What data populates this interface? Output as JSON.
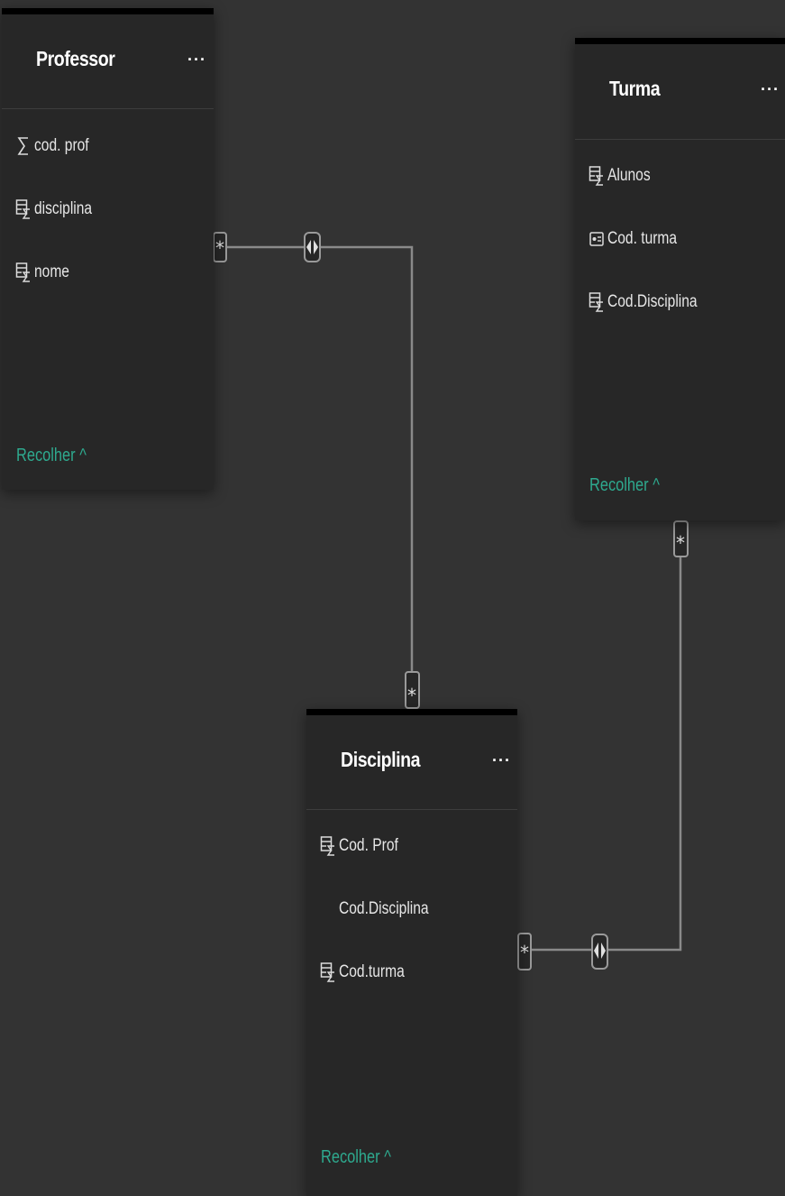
{
  "tables": {
    "professor": {
      "title": "Professor",
      "menu": "···",
      "fields": [
        {
          "label": "cod. prof",
          "icon": "sigma-icon"
        },
        {
          "label": "disciplina",
          "icon": "calculated-column-icon"
        },
        {
          "label": "nome",
          "icon": "calculated-column-icon"
        }
      ],
      "collapse_label": "Recolher ^"
    },
    "turma": {
      "title": "Turma",
      "menu": "···",
      "fields": [
        {
          "label": "Alunos",
          "icon": "calculated-column-icon"
        },
        {
          "label": "Cod. turma",
          "icon": "key-column-icon"
        },
        {
          "label": "Cod.Disciplina",
          "icon": "calculated-column-icon"
        }
      ],
      "collapse_label": "Recolher ^"
    },
    "disciplina": {
      "title": "Disciplina",
      "menu": "···",
      "fields": [
        {
          "label": "Cod. Prof",
          "icon": "calculated-column-icon"
        },
        {
          "label": "Cod.Disciplina",
          "icon": ""
        },
        {
          "label": "Cod.turma",
          "icon": "calculated-column-icon"
        }
      ],
      "collapse_label": "Recolher ^"
    }
  },
  "relationships": [
    {
      "from": "Professor",
      "to": "Disciplina",
      "from_cardinality": "*",
      "to_cardinality": "*",
      "filter": "both-directions-icon"
    },
    {
      "from": "Disciplina",
      "to": "Turma",
      "from_cardinality": "*",
      "to_cardinality": "*",
      "filter": "both-directions-icon"
    }
  ],
  "colors": {
    "canvas": "#333333",
    "card": "#272727",
    "card_top_border": "#000000",
    "accent": "#2eaa8f",
    "connector": "#8a8a8a"
  }
}
